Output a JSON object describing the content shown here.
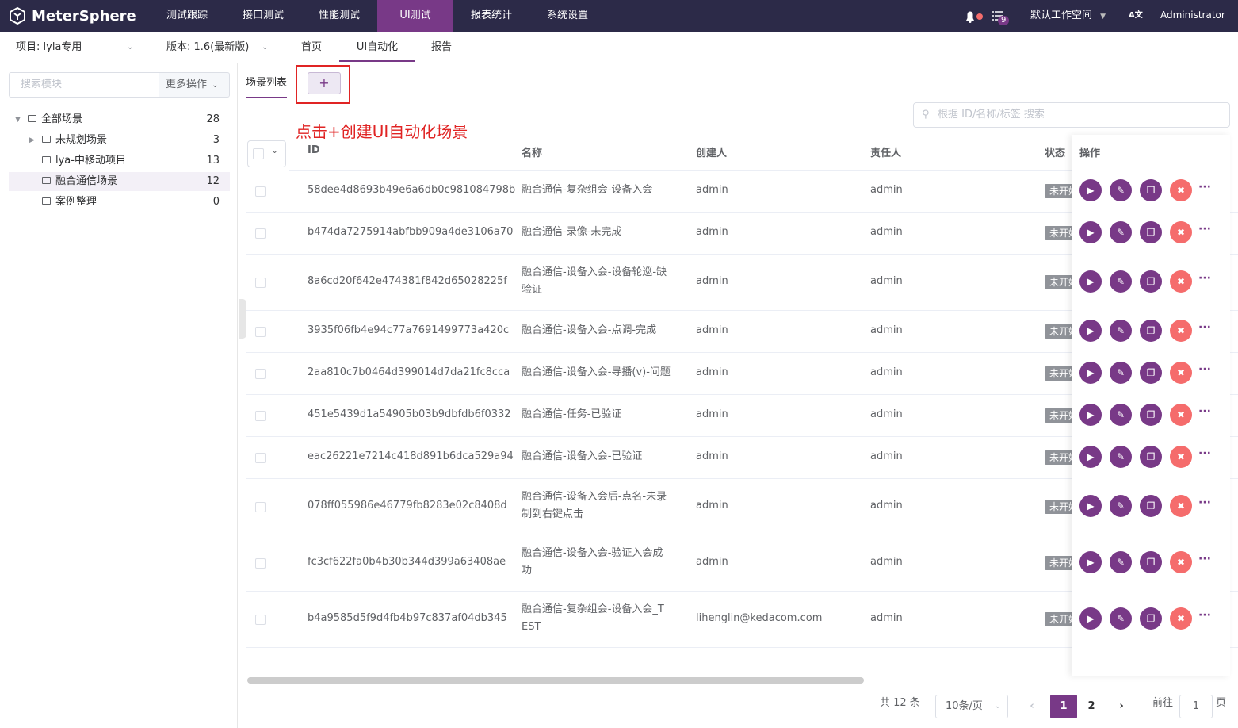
{
  "topbar": {
    "logo": "MeterSphere",
    "nav": [
      "测试跟踪",
      "接口测试",
      "性能测试",
      "UI测试",
      "报表统计",
      "系统设置"
    ],
    "active_nav": "UI测试",
    "notification_badge": "9",
    "workspace": "默认工作空间",
    "lang_icon": "A文",
    "user": "Administrator"
  },
  "subbar": {
    "project": "项目: lyla专用",
    "version": "版本: 1.6(最新版)",
    "tabs": [
      "首页",
      "UI自动化",
      "报告"
    ],
    "active_tab": "UI自动化"
  },
  "sidebar": {
    "search_placeholder": "搜索模块",
    "more_ops": "更多操作",
    "tree": [
      {
        "label": "全部场景",
        "count": "28"
      },
      {
        "label": "未规划场景",
        "count": "3"
      },
      {
        "label": "lya-中移动项目",
        "count": "13"
      },
      {
        "label": "融合通信场景",
        "count": "12"
      },
      {
        "label": "案例整理",
        "count": "0"
      }
    ]
  },
  "main": {
    "tab_label": "场景列表",
    "add_label": "+",
    "annotation": "点击+创建UI自动化场景",
    "search_placeholder": "根据 ID/名称/标签 搜索",
    "columns": {
      "id": "ID",
      "name": "名称",
      "creator": "创建人",
      "owner": "责任人",
      "status": "状态",
      "ops": "操作"
    },
    "rows": [
      {
        "id": "58dee4d8693b49e6a6db0c981084798b",
        "name": "融合通信-复杂组会-设备入会",
        "name2": "",
        "creator": "admin",
        "owner": "admin",
        "status": "未开始"
      },
      {
        "id": "b474da7275914abfbb909a4de3106a70",
        "name": "融合通信-录像-未完成",
        "name2": "",
        "creator": "admin",
        "owner": "admin",
        "status": "未开始"
      },
      {
        "id": "8a6cd20f642e474381f842d65028225f",
        "name": "融合通信-设备入会-设备轮巡-缺",
        "name2": "验证",
        "creator": "admin",
        "owner": "admin",
        "status": "未开始"
      },
      {
        "id": "3935f06fb4e94c77a7691499773a420c",
        "name": "融合通信-设备入会-点调-完成",
        "name2": "",
        "creator": "admin",
        "owner": "admin",
        "status": "未开始"
      },
      {
        "id": "2aa810c7b0464d399014d7da21fc8cca",
        "name": "融合通信-设备入会-导播(v)-问题",
        "name2": "",
        "creator": "admin",
        "owner": "admin",
        "status": "未开始"
      },
      {
        "id": "451e5439d1a54905b03b9dbfdb6f0332",
        "name": "融合通信-任务-已验证",
        "name2": "",
        "creator": "admin",
        "owner": "admin",
        "status": "未开始"
      },
      {
        "id": "eac26221e7214c418d891b6dca529a94",
        "name": "融合通信-设备入会-已验证",
        "name2": "",
        "creator": "admin",
        "owner": "admin",
        "status": "未开始"
      },
      {
        "id": "078ff055986e46779fb8283e02c8408d",
        "name": "融合通信-设备入会后-点名-未录",
        "name2": "制到右键点击",
        "creator": "admin",
        "owner": "admin",
        "status": "未开始"
      },
      {
        "id": "fc3cf622fa0b4b30b344d399a63408ae",
        "name": "融合通信-设备入会-验证入会成",
        "name2": "功",
        "creator": "admin",
        "owner": "admin",
        "status": "未开始"
      },
      {
        "id": "b4a9585d5f9d4fb4b97c837af04db345",
        "name": "融合通信-复杂组会-设备入会_T",
        "name2": "EST",
        "creator": "lihenglin@kedacom.com",
        "owner": "admin",
        "status": "未开始"
      }
    ]
  },
  "pagination": {
    "total": "共 12 条",
    "page_size": "10条/页",
    "pages": [
      "1",
      "2"
    ],
    "goto_label": "前往",
    "goto_value": "1",
    "page_suffix": "页"
  },
  "colors": {
    "primary": "#783987",
    "topbar": "#2c2a48",
    "danger": "#f56c6c",
    "annotation": "#e02424"
  }
}
